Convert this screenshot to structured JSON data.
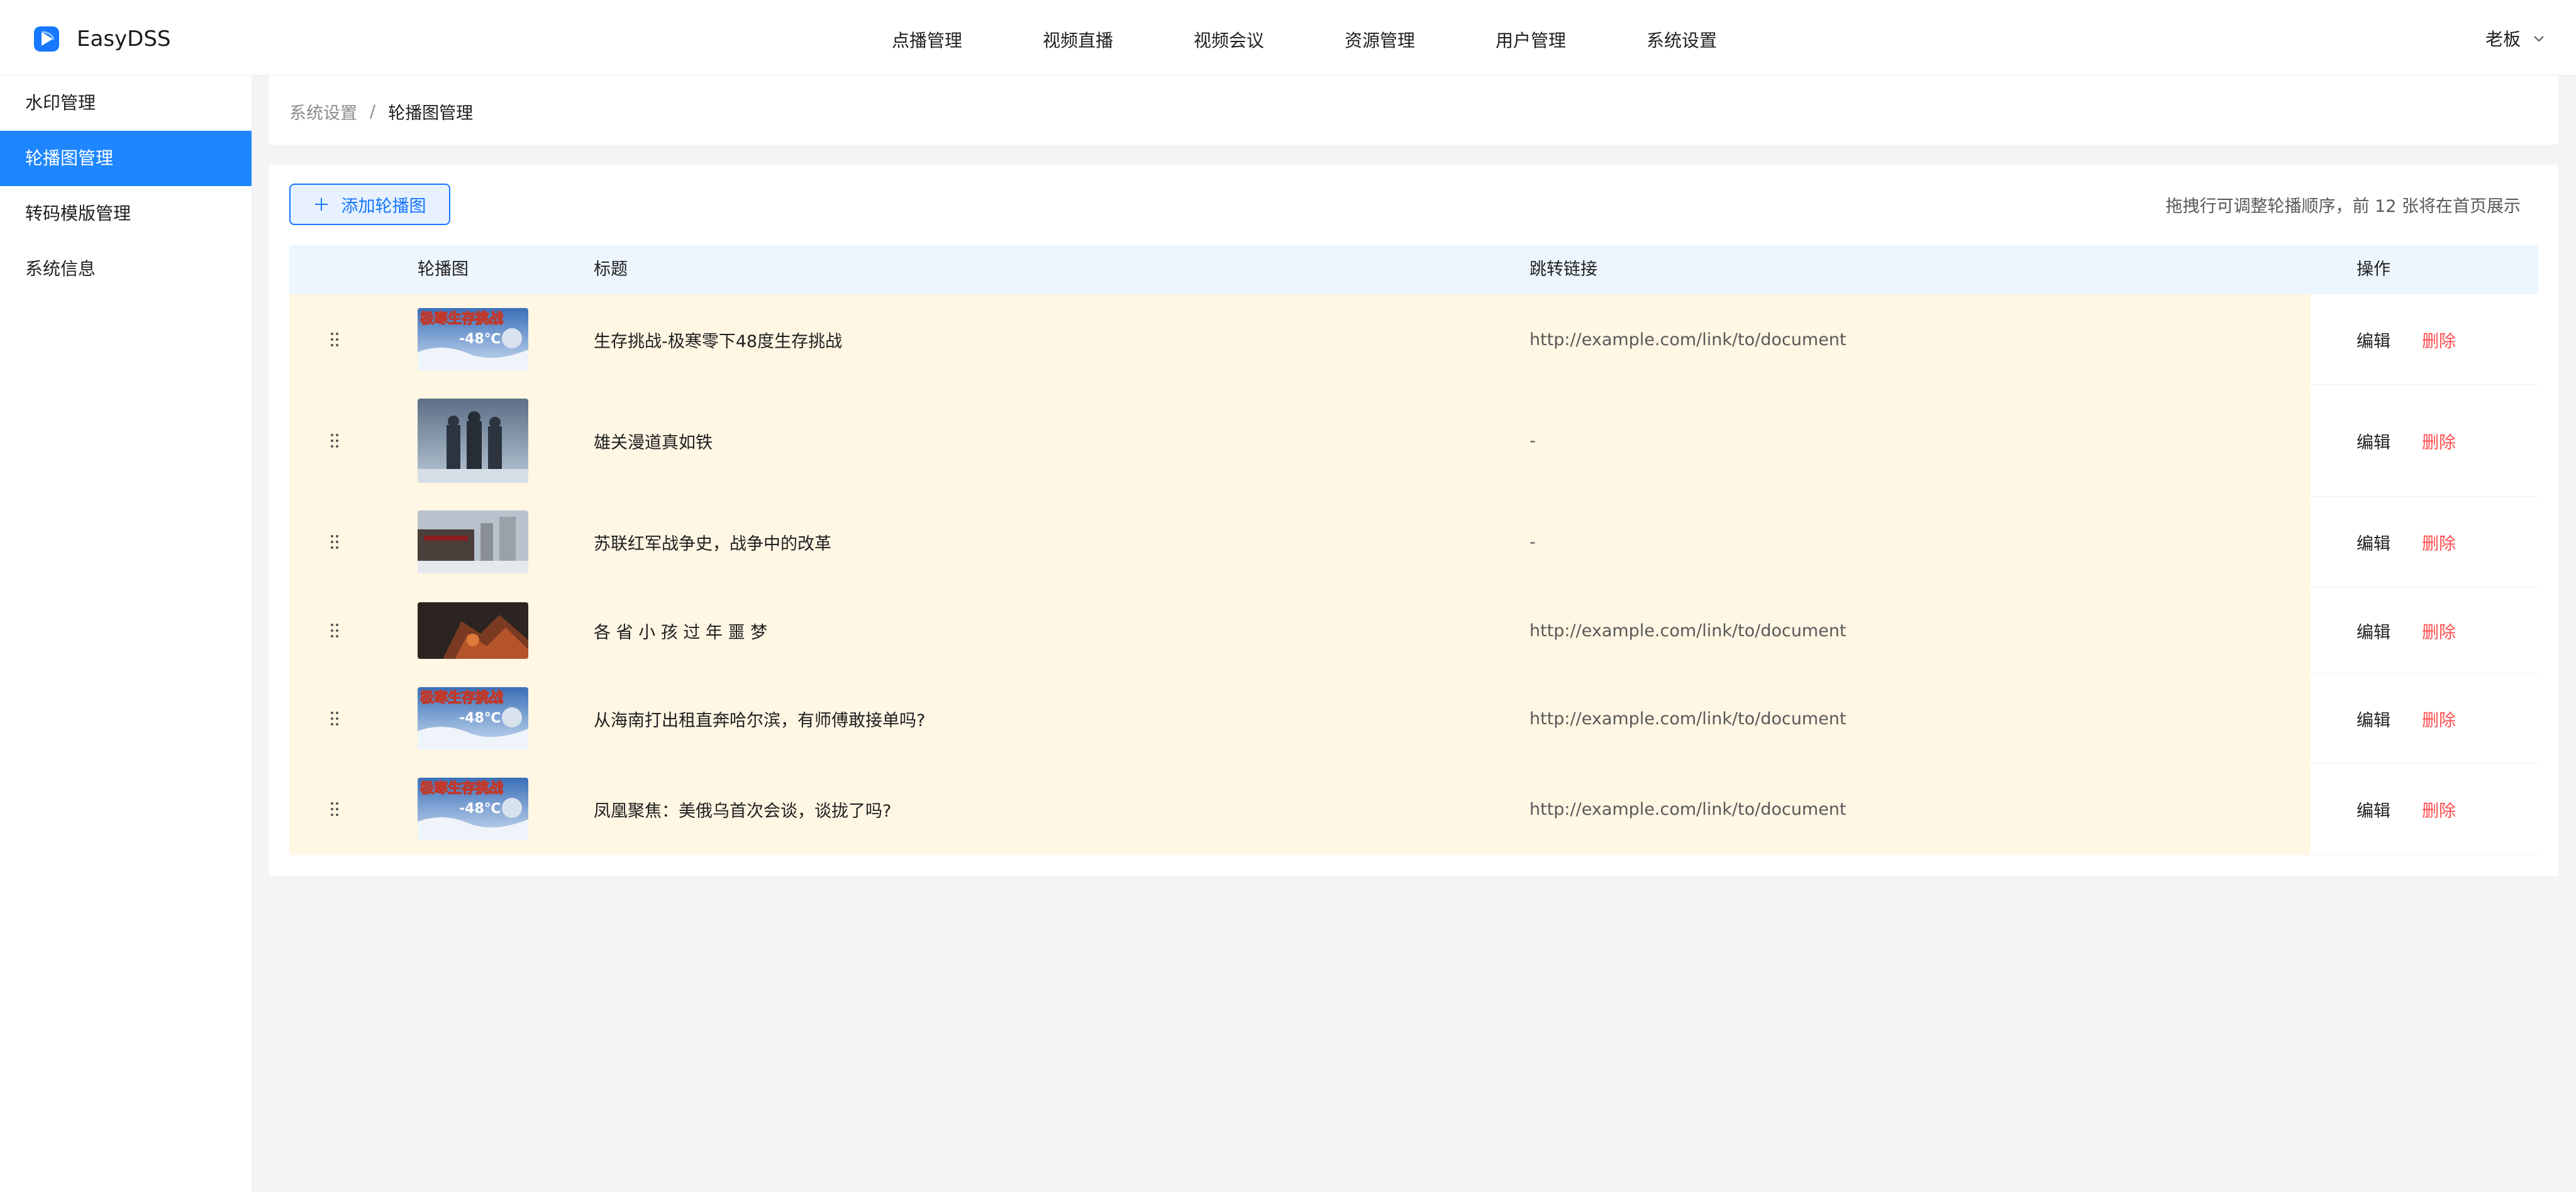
{
  "app": {
    "name": "EasyDSS"
  },
  "nav": [
    {
      "label": "点播管理"
    },
    {
      "label": "视频直播"
    },
    {
      "label": "视频会议"
    },
    {
      "label": "资源管理"
    },
    {
      "label": "用户管理"
    },
    {
      "label": "系统设置",
      "active": true
    }
  ],
  "user": {
    "name": "老板"
  },
  "sidebar": {
    "items": [
      {
        "label": "水印管理"
      },
      {
        "label": "轮播图管理",
        "active": true
      },
      {
        "label": "转码模版管理"
      },
      {
        "label": "系统信息"
      }
    ]
  },
  "breadcrumb": {
    "parent": "系统设置",
    "separator": "/",
    "current": "轮播图管理"
  },
  "toolbar": {
    "add_label": "添加轮播图",
    "hint": "拖拽行可调整轮播顺序，前 12 张将在首页展示"
  },
  "table": {
    "columns": {
      "image": "轮播图",
      "title": "标题",
      "link": "跳转链接",
      "actions": "操作"
    },
    "edit_label": "编辑",
    "delete_label": "删除",
    "rows": [
      {
        "title": "生存挑战-极寒零下48度生存挑战",
        "link": "http://example.com/link/to/document",
        "thumb_text": "极寒生存挑战",
        "thumb_sub": "-48℃"
      },
      {
        "title": "雄关漫道真如铁",
        "link": "-"
      },
      {
        "title": "苏联红军战争史，战争中的改革",
        "link": "-"
      },
      {
        "title": "各 省 小 孩 过 年 噩 梦",
        "link": "http://example.com/link/to/document"
      },
      {
        "title": "从海南打出租直奔哈尔滨，有师傅敢接单吗?",
        "link": "http://example.com/link/to/document",
        "thumb_text": "极寒生存挑战",
        "thumb_sub": "-48℃"
      },
      {
        "title": "凤凰聚焦：美俄乌首次会谈，谈拢了吗?",
        "link": "http://example.com/link/to/document",
        "thumb_text": "极寒生存挑战",
        "thumb_sub": "-48℃"
      }
    ]
  },
  "colors": {
    "accent": "#1677ff",
    "sidebar_active": "#1e86ff",
    "row_highlight": "#fff6e3",
    "danger": "#ff4d4f",
    "table_header": "#edf5ff"
  }
}
